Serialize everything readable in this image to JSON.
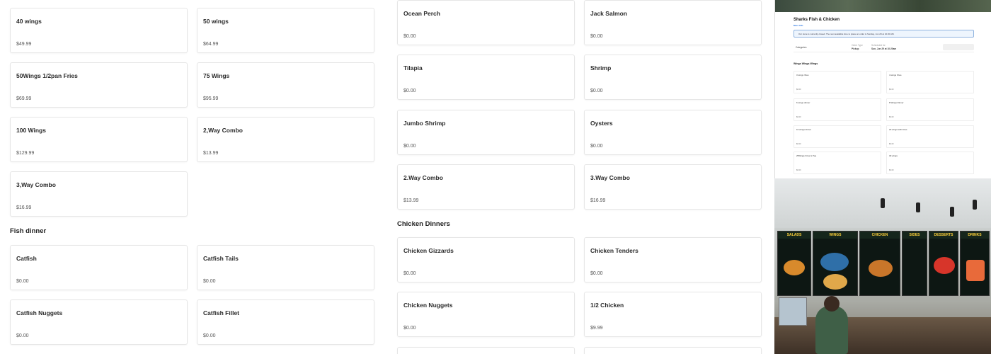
{
  "left_column": {
    "items": [
      {
        "name": "40 wings",
        "price": "$49.99"
      },
      {
        "name": "50 wings",
        "price": "$64.99"
      },
      {
        "name": "50Wings 1/2pan Fries",
        "price": "$69.99"
      },
      {
        "name": "75 Wings",
        "price": "$95.99"
      },
      {
        "name": "100 Wings",
        "price": "$129.99"
      },
      {
        "name": "2,Way Combo",
        "price": "$13.99"
      },
      {
        "name": "3,Way Combo",
        "price": "$16.99"
      }
    ],
    "fish_dinner": {
      "title": "Fish dinner",
      "items": [
        {
          "name": "Catfish",
          "price": "$0.00"
        },
        {
          "name": "Catfish Tails",
          "price": "$0.00"
        },
        {
          "name": "Catfish Nuggets",
          "price": "$0.00"
        },
        {
          "name": "Catfish Fillet",
          "price": "$0.00"
        }
      ]
    }
  },
  "middle_column": {
    "items": [
      {
        "name": "Ocean Perch",
        "price": "$0.00"
      },
      {
        "name": "Jack Salmon",
        "price": "$0.00"
      },
      {
        "name": "Tilapia",
        "price": "$0.00"
      },
      {
        "name": "Shrimp",
        "price": "$0.00"
      },
      {
        "name": "Jumbo Shrimp",
        "price": "$0.00"
      },
      {
        "name": "Oysters",
        "price": "$0.00"
      },
      {
        "name": "2.Way Combo",
        "price": "$13.99"
      },
      {
        "name": "3.Way Combo",
        "price": "$16.99"
      }
    ],
    "chicken_dinners": {
      "title": "Chicken Dinners",
      "items": [
        {
          "name": "Chicken Gizzards",
          "price": "$0.00"
        },
        {
          "name": "Chicken Tenders",
          "price": "$0.00"
        },
        {
          "name": "Chicken Nuggets",
          "price": "$0.00"
        },
        {
          "name": "1/2 Chicken",
          "price": "$9.99"
        }
      ]
    }
  },
  "thumbnail": {
    "store_name": "Sharks Fish & Chicken",
    "more_info": "More Info",
    "notice": "Our store is currently closed. The next available time to place an order is Sunday, Jun 29 at 10:20 AM.",
    "categories": "Categories",
    "order_type_label": "Order Type",
    "order_type": "Pickup",
    "schedule_label": "Scheduled for",
    "schedule": "Sun, Jun 29 at 10:20am",
    "section": "Wings Wings Wings",
    "items": [
      {
        "name": "3 wings /fries",
        "price": "$0.00"
      },
      {
        "name": "4 wings /fries",
        "price": "$0.00"
      },
      {
        "name": "6 wings dinner",
        "price": "$0.00"
      },
      {
        "name": "8 Wings Dinner",
        "price": "$0.00"
      },
      {
        "name": "10 wings dinner",
        "price": "$0.00"
      },
      {
        "name": "20 wings with Fries",
        "price": "$0.00"
      },
      {
        "name": "25Wings Fries & Pop",
        "price": "$0.00"
      },
      {
        "name": "30 wings",
        "price": "$0.00"
      }
    ],
    "board_headers": [
      "SALADS",
      "WINGS",
      "CHICKEN",
      "SIDES",
      "DESSERTS",
      "DRINKS"
    ]
  }
}
